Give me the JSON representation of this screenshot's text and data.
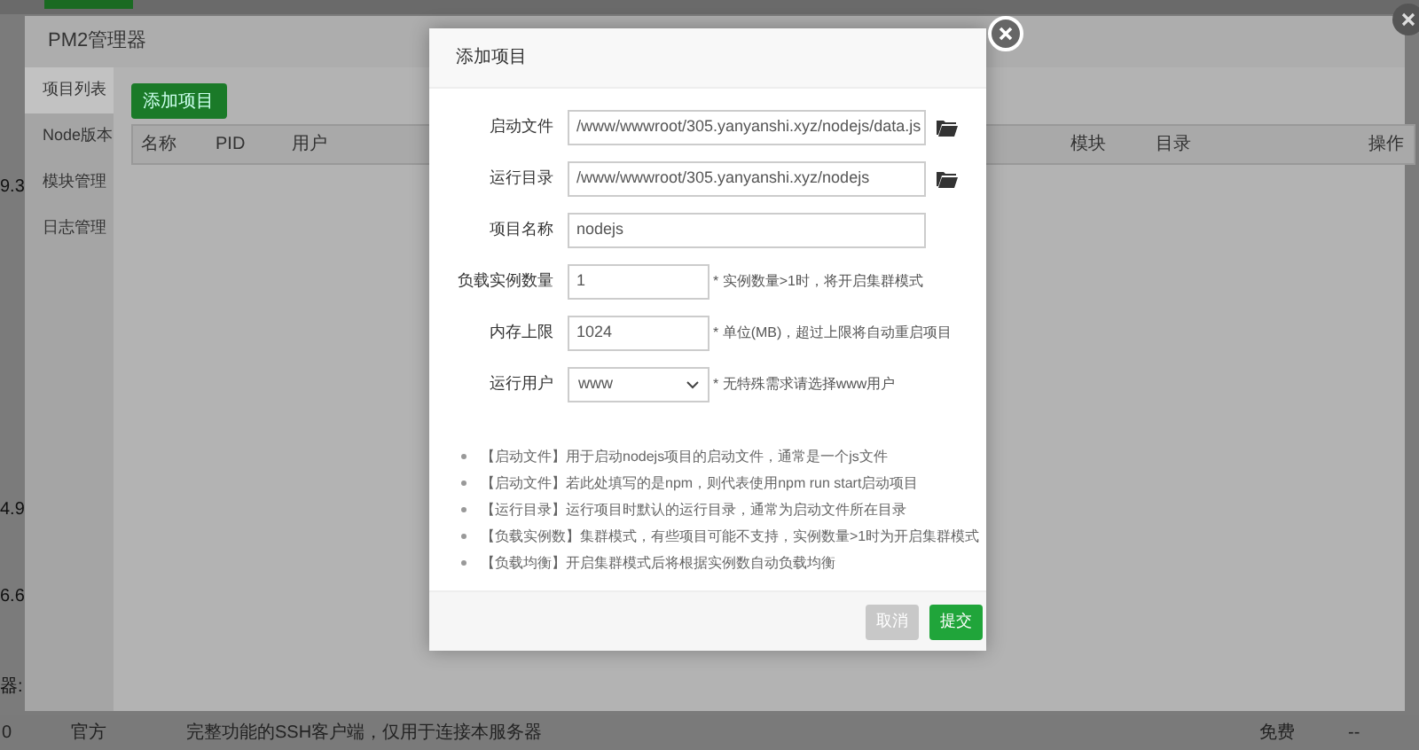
{
  "background_page": {
    "left_cells": [
      "9.3",
      "4.9",
      "6.6",
      "器:"
    ],
    "bottom_row": {
      "version": "0",
      "source": "官方",
      "description": "完整功能的SSH客户端，仅用于连接本服务器",
      "price": "免费",
      "expiry": "--"
    }
  },
  "pm2_window": {
    "title": "PM2管理器",
    "sidebar": [
      {
        "label": "项目列表",
        "selected": true
      },
      {
        "label": "Node版本",
        "selected": false
      },
      {
        "label": "模块管理",
        "selected": false
      },
      {
        "label": "日志管理",
        "selected": false
      }
    ],
    "add_button": "添加项目",
    "table": {
      "columns": [
        "名称",
        "PID",
        "用户",
        "模块",
        "目录",
        "操作"
      ]
    }
  },
  "dialog": {
    "title": "添加项目",
    "fields": [
      {
        "kind": "path",
        "label": "启动文件",
        "value": "/www/wwwroot/305.yanyanshi.xyz/nodejs/data.js"
      },
      {
        "kind": "path",
        "label": "运行目录",
        "value": "/www/wwwroot/305.yanyanshi.xyz/nodejs"
      },
      {
        "kind": "text",
        "label": "项目名称",
        "value": "nodejs"
      },
      {
        "kind": "short",
        "label": "负载实例数量",
        "value": "1",
        "note": "* 实例数量>1时，将开启集群模式"
      },
      {
        "kind": "short",
        "label": "内存上限",
        "value": "1024",
        "note": "* 单位(MB)，超过上限将自动重启项目"
      },
      {
        "kind": "select",
        "label": "运行用户",
        "value": "www",
        "note": "* 无特殊需求请选择www用户"
      }
    ],
    "notes": [
      "【启动文件】用于启动nodejs项目的启动文件，通常是一个js文件",
      "【启动文件】若此处填写的是npm，则代表使用npm run start启动项目",
      "【运行目录】运行项目时默认的运行目录，通常为启动文件所在目录",
      "【负载实例数】集群模式，有些项目可能不支持，实例数量>1时为开启集群模式",
      "【负载均衡】开启集群模式后将根据实例数自动负载均衡"
    ],
    "buttons": [
      {
        "kind": "cancel",
        "label": "取消"
      },
      {
        "kind": "primary",
        "label": "提交"
      }
    ]
  }
}
